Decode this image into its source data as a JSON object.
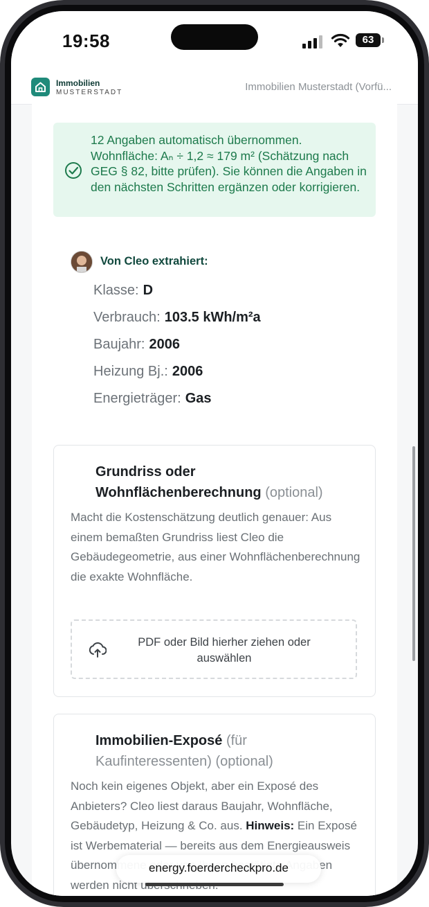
{
  "status_bar": {
    "time": "19:58",
    "battery": "63"
  },
  "app_bar": {
    "brand_line1": "Immobilien",
    "brand_line2": "MUSTERSTADT",
    "app_name": "Immobilien Musterstadt (Vorfü..."
  },
  "banner": {
    "text": "12 Angaben automatisch übernommen. Wohnfläche: Aₙ ÷ 1,2 ≈ 179 m² (Schätzung nach GEG § 82, bitte prüfen). Sie können die Angaben in den nächsten Schritten ergänzen oder korrigieren."
  },
  "extraction": {
    "title": "Von Cleo extrahiert:",
    "fields": [
      {
        "label": "Klasse:",
        "value": "D"
      },
      {
        "label": "Verbrauch:",
        "value": "103.5 kWh/m²a"
      },
      {
        "label": "Baujahr:",
        "value": "2006"
      },
      {
        "label": "Heizung Bj.:",
        "value": "2006"
      },
      {
        "label": "Energieträger:",
        "value": "Gas"
      }
    ]
  },
  "floorplan_card": {
    "title_line1": "Grundriss oder",
    "title_line2": "Wohnflächenberechnung",
    "optional": "(optional)",
    "description": "Macht die Kostenschätzung deutlich genauer: Aus einem bemaßten Grundriss liest Cleo die Gebäudegeometrie, aus einer Wohnflächenberechnung die exakte Wohnfläche.",
    "dropzone_text": "PDF oder Bild hierher ziehen oder auswählen"
  },
  "expose_card": {
    "title_main": "Immobilien-Exposé",
    "title_sub1": "(für",
    "title_sub2": "Kaufinteressenten)",
    "optional": "(optional)",
    "description": "Noch kein eigenes Objekt, aber ein Exposé des Anbieters? Cleo liest daraus Baujahr, Wohnfläche, Gebäudetyp, Heizung & Co. aus.",
    "hint_label": "Hinweis:",
    "hint_text": "Ein Exposé ist Werbematerial — bereits aus dem Energieausweis übernommene oder von Ihnen bestätigte Angaben werden nicht überschrieben."
  },
  "browser": {
    "url": "energy.foerdercheckpro.de"
  }
}
